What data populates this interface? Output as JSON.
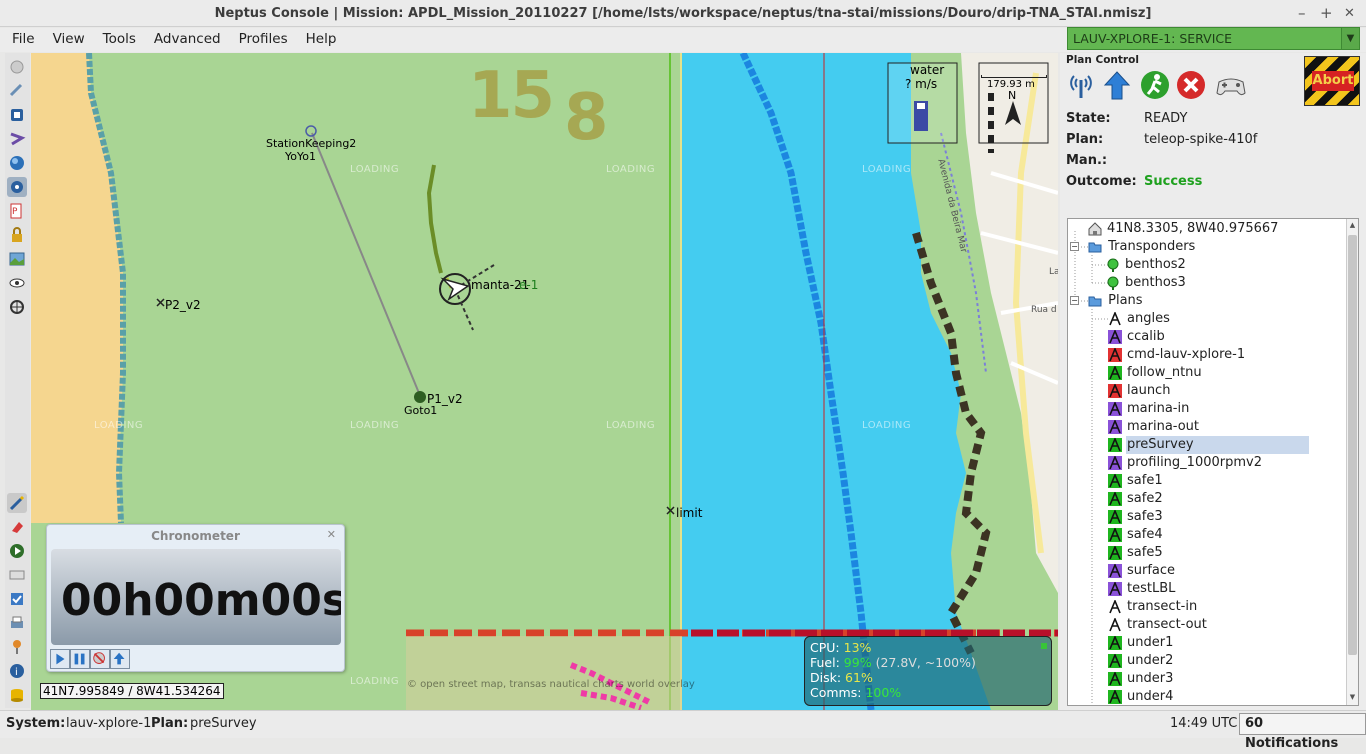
{
  "window": {
    "title": "Neptus Console | Mission: APDL_Mission_20110227 [/home/lsts/workspace/neptus/tna-stai/missions/Douro/drip-TNA_STAI.nmisz]",
    "minimize": "–",
    "maximize": "+",
    "close": "✕"
  },
  "menu": [
    "File",
    "View",
    "Tools",
    "Advanced",
    "Profiles",
    "Help"
  ],
  "vehicle_selector": {
    "value": "LAUV-XPLORE-1: SERVICE",
    "color": "#63b751"
  },
  "plan_control": {
    "title": "Plan Control",
    "abort_label": "Abort",
    "state_label": "State:",
    "state_value": "READY",
    "plan_label": "Plan:",
    "plan_value": "teleop-spike-410f",
    "man_label": "Man.:",
    "man_value": "",
    "outcome_label": "Outcome:",
    "outcome_value": "Success",
    "outcome_color": "#1fa11f"
  },
  "tree": {
    "home": "41N8.3305, 8W40.975667",
    "transponders_label": "Transponders",
    "transponders": [
      "benthos2",
      "benthos3"
    ],
    "plans_label": "Plans",
    "plans": [
      {
        "name": "angles",
        "status": "none"
      },
      {
        "name": "ccalib",
        "status": "purple"
      },
      {
        "name": "cmd-lauv-xplore-1",
        "status": "red"
      },
      {
        "name": "follow_ntnu",
        "status": "green"
      },
      {
        "name": "launch",
        "status": "red"
      },
      {
        "name": "marina-in",
        "status": "purple"
      },
      {
        "name": "marina-out",
        "status": "purple"
      },
      {
        "name": "preSurvey",
        "status": "green",
        "selected": true
      },
      {
        "name": "profiling_1000rpmv2",
        "status": "purple"
      },
      {
        "name": "safe1",
        "status": "green"
      },
      {
        "name": "safe2",
        "status": "green"
      },
      {
        "name": "safe3",
        "status": "green"
      },
      {
        "name": "safe4",
        "status": "green"
      },
      {
        "name": "safe5",
        "status": "green"
      },
      {
        "name": "surface",
        "status": "purple"
      },
      {
        "name": "testLBL",
        "status": "purple"
      },
      {
        "name": "transect-in",
        "status": "none"
      },
      {
        "name": "transect-out",
        "status": "none"
      },
      {
        "name": "under1",
        "status": "green"
      },
      {
        "name": "under2",
        "status": "green"
      },
      {
        "name": "under3",
        "status": "green"
      },
      {
        "name": "under4",
        "status": "green"
      }
    ]
  },
  "map": {
    "big_number_1": "15",
    "big_number_2": "8",
    "water_label": "water",
    "water_speed": "? m/s",
    "scale_label": "179.93 m",
    "compass_label": "N",
    "loading_text": "LOADING",
    "street_1": "Avenida da Beira Mar",
    "street_2": "Rua d",
    "street_3": "La",
    "markers": {
      "station_keeping": "StationKeeping2",
      "yoyo": "YoYo1",
      "vehicle": "manta-21",
      "vehicle_overlap": "e-1",
      "p2": "P2_v2",
      "p1": "P1_v2",
      "goto": "Goto1",
      "limit": "limit"
    },
    "attribution": "© open street map, transas nautical charts world overlay",
    "coords": "41N7.995849 / 8W41.534264"
  },
  "chronometer": {
    "title": "Chronometer",
    "close": "✕",
    "time": "00h00m00s"
  },
  "system_info": {
    "cpu_label": "CPU:",
    "cpu_value": "13%",
    "fuel_label": "Fuel:",
    "fuel_value": "99%",
    "fuel_detail": "(27.8V, ~100%)",
    "disk_label": "Disk:",
    "disk_value": "61%",
    "comms_label": "Comms:",
    "comms_value": "100%"
  },
  "statusbar": {
    "system_label": "System:",
    "system_value": "lauv-xplore-1",
    "plan_label": "Plan:",
    "plan_value": "preSurvey",
    "time": "14:49 UTC",
    "notifications": "60 Notifications"
  }
}
